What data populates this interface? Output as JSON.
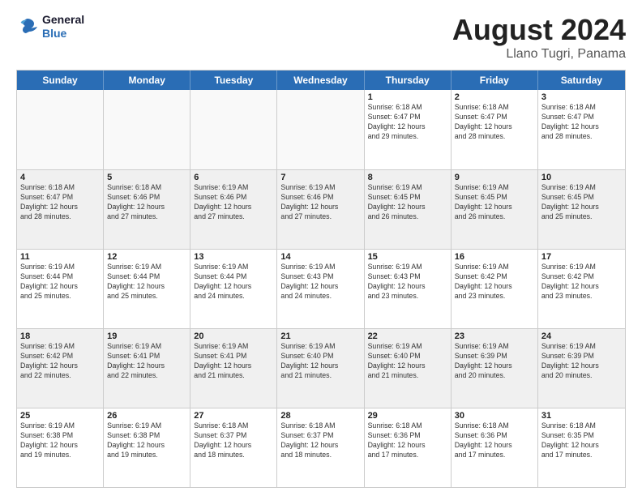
{
  "header": {
    "logo_line1": "General",
    "logo_line2": "Blue",
    "title": "August 2024",
    "location": "Llano Tugri, Panama"
  },
  "weekdays": [
    "Sunday",
    "Monday",
    "Tuesday",
    "Wednesday",
    "Thursday",
    "Friday",
    "Saturday"
  ],
  "weeks": [
    [
      {
        "day": "",
        "info": ""
      },
      {
        "day": "",
        "info": ""
      },
      {
        "day": "",
        "info": ""
      },
      {
        "day": "",
        "info": ""
      },
      {
        "day": "1",
        "info": "Sunrise: 6:18 AM\nSunset: 6:47 PM\nDaylight: 12 hours\nand 29 minutes."
      },
      {
        "day": "2",
        "info": "Sunrise: 6:18 AM\nSunset: 6:47 PM\nDaylight: 12 hours\nand 28 minutes."
      },
      {
        "day": "3",
        "info": "Sunrise: 6:18 AM\nSunset: 6:47 PM\nDaylight: 12 hours\nand 28 minutes."
      }
    ],
    [
      {
        "day": "4",
        "info": "Sunrise: 6:18 AM\nSunset: 6:47 PM\nDaylight: 12 hours\nand 28 minutes."
      },
      {
        "day": "5",
        "info": "Sunrise: 6:18 AM\nSunset: 6:46 PM\nDaylight: 12 hours\nand 27 minutes."
      },
      {
        "day": "6",
        "info": "Sunrise: 6:19 AM\nSunset: 6:46 PM\nDaylight: 12 hours\nand 27 minutes."
      },
      {
        "day": "7",
        "info": "Sunrise: 6:19 AM\nSunset: 6:46 PM\nDaylight: 12 hours\nand 27 minutes."
      },
      {
        "day": "8",
        "info": "Sunrise: 6:19 AM\nSunset: 6:45 PM\nDaylight: 12 hours\nand 26 minutes."
      },
      {
        "day": "9",
        "info": "Sunrise: 6:19 AM\nSunset: 6:45 PM\nDaylight: 12 hours\nand 26 minutes."
      },
      {
        "day": "10",
        "info": "Sunrise: 6:19 AM\nSunset: 6:45 PM\nDaylight: 12 hours\nand 25 minutes."
      }
    ],
    [
      {
        "day": "11",
        "info": "Sunrise: 6:19 AM\nSunset: 6:44 PM\nDaylight: 12 hours\nand 25 minutes."
      },
      {
        "day": "12",
        "info": "Sunrise: 6:19 AM\nSunset: 6:44 PM\nDaylight: 12 hours\nand 25 minutes."
      },
      {
        "day": "13",
        "info": "Sunrise: 6:19 AM\nSunset: 6:44 PM\nDaylight: 12 hours\nand 24 minutes."
      },
      {
        "day": "14",
        "info": "Sunrise: 6:19 AM\nSunset: 6:43 PM\nDaylight: 12 hours\nand 24 minutes."
      },
      {
        "day": "15",
        "info": "Sunrise: 6:19 AM\nSunset: 6:43 PM\nDaylight: 12 hours\nand 23 minutes."
      },
      {
        "day": "16",
        "info": "Sunrise: 6:19 AM\nSunset: 6:42 PM\nDaylight: 12 hours\nand 23 minutes."
      },
      {
        "day": "17",
        "info": "Sunrise: 6:19 AM\nSunset: 6:42 PM\nDaylight: 12 hours\nand 23 minutes."
      }
    ],
    [
      {
        "day": "18",
        "info": "Sunrise: 6:19 AM\nSunset: 6:42 PM\nDaylight: 12 hours\nand 22 minutes."
      },
      {
        "day": "19",
        "info": "Sunrise: 6:19 AM\nSunset: 6:41 PM\nDaylight: 12 hours\nand 22 minutes."
      },
      {
        "day": "20",
        "info": "Sunrise: 6:19 AM\nSunset: 6:41 PM\nDaylight: 12 hours\nand 21 minutes."
      },
      {
        "day": "21",
        "info": "Sunrise: 6:19 AM\nSunset: 6:40 PM\nDaylight: 12 hours\nand 21 minutes."
      },
      {
        "day": "22",
        "info": "Sunrise: 6:19 AM\nSunset: 6:40 PM\nDaylight: 12 hours\nand 21 minutes."
      },
      {
        "day": "23",
        "info": "Sunrise: 6:19 AM\nSunset: 6:39 PM\nDaylight: 12 hours\nand 20 minutes."
      },
      {
        "day": "24",
        "info": "Sunrise: 6:19 AM\nSunset: 6:39 PM\nDaylight: 12 hours\nand 20 minutes."
      }
    ],
    [
      {
        "day": "25",
        "info": "Sunrise: 6:19 AM\nSunset: 6:38 PM\nDaylight: 12 hours\nand 19 minutes."
      },
      {
        "day": "26",
        "info": "Sunrise: 6:19 AM\nSunset: 6:38 PM\nDaylight: 12 hours\nand 19 minutes."
      },
      {
        "day": "27",
        "info": "Sunrise: 6:18 AM\nSunset: 6:37 PM\nDaylight: 12 hours\nand 18 minutes."
      },
      {
        "day": "28",
        "info": "Sunrise: 6:18 AM\nSunset: 6:37 PM\nDaylight: 12 hours\nand 18 minutes."
      },
      {
        "day": "29",
        "info": "Sunrise: 6:18 AM\nSunset: 6:36 PM\nDaylight: 12 hours\nand 17 minutes."
      },
      {
        "day": "30",
        "info": "Sunrise: 6:18 AM\nSunset: 6:36 PM\nDaylight: 12 hours\nand 17 minutes."
      },
      {
        "day": "31",
        "info": "Sunrise: 6:18 AM\nSunset: 6:35 PM\nDaylight: 12 hours\nand 17 minutes."
      }
    ]
  ]
}
